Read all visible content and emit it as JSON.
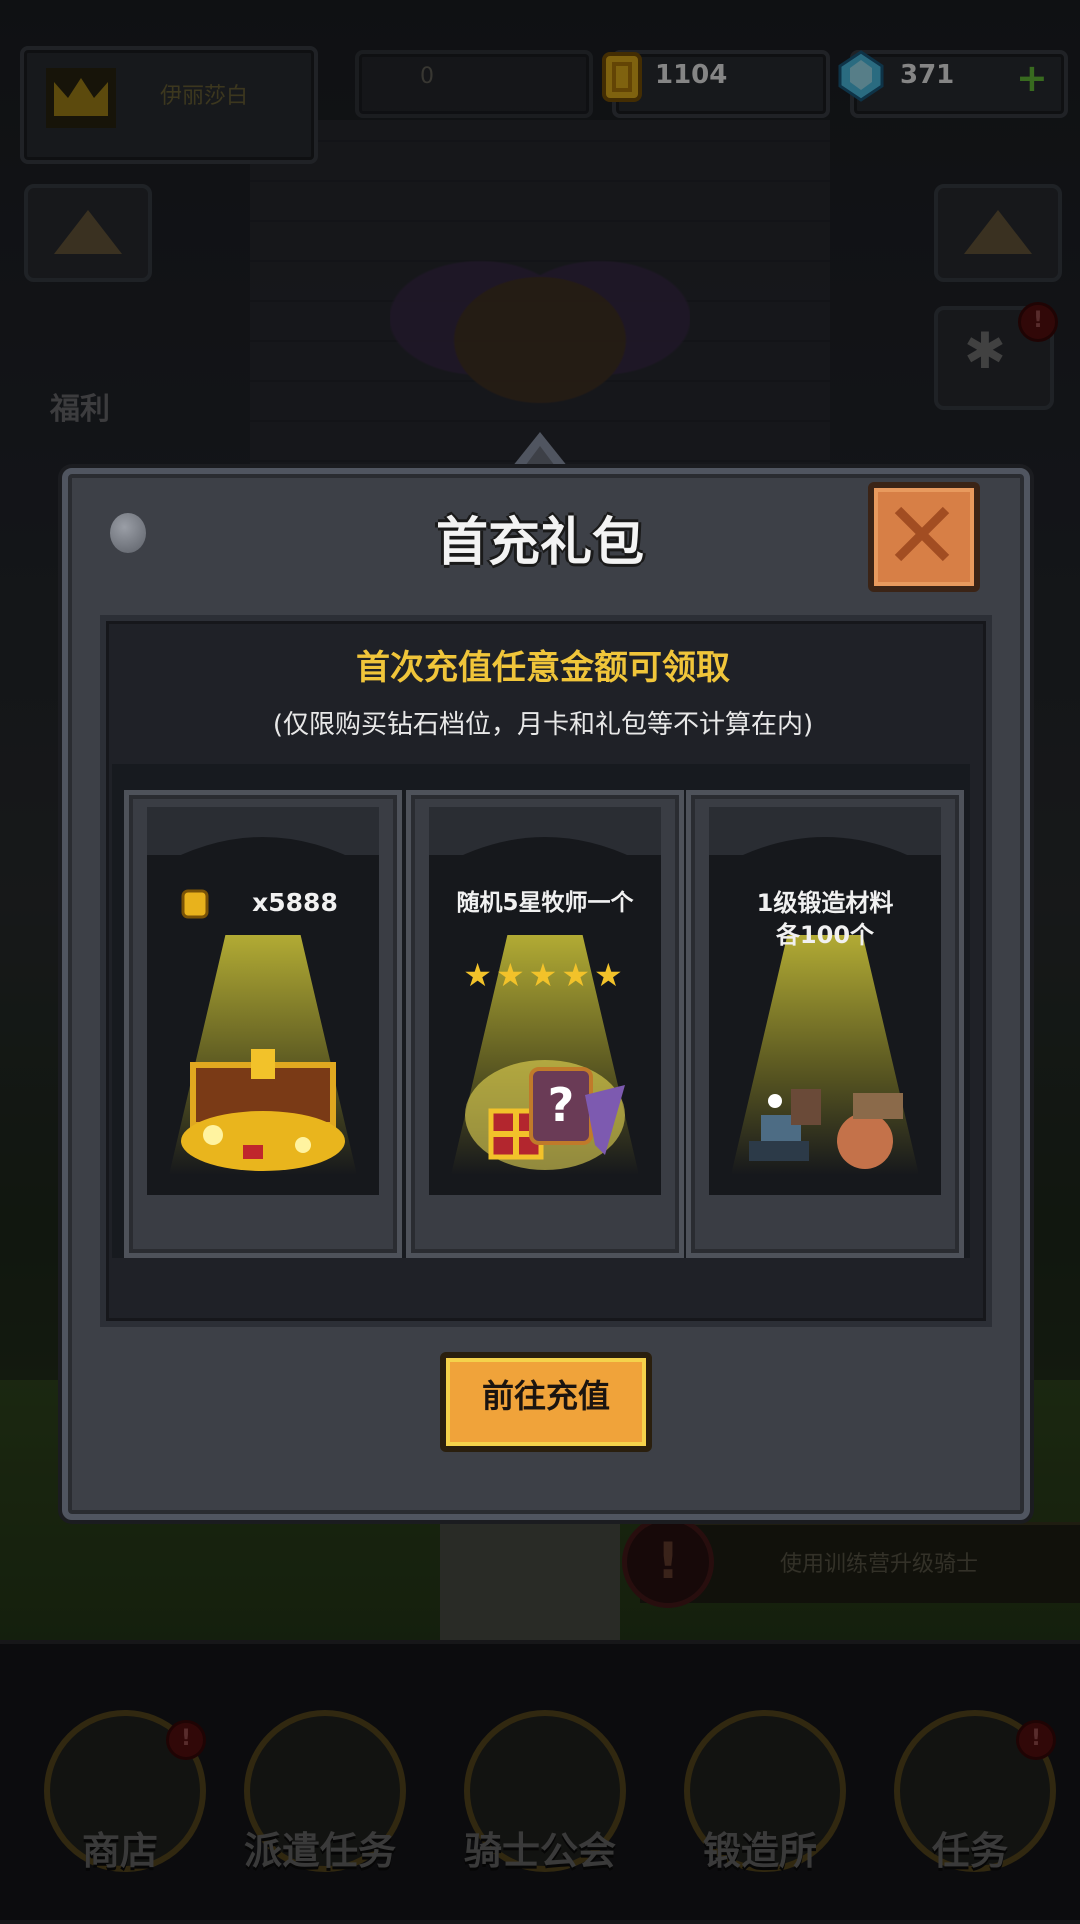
{
  "hud": {
    "player_name": "伊丽莎白",
    "honor_value": "0",
    "gold_value": "1104",
    "gem_value": "371",
    "gem_plus": "+"
  },
  "side": {
    "welfare_label": "福利",
    "settings_glyph": "✱",
    "badge_glyph": "!"
  },
  "notice": {
    "icon_glyph": "!",
    "text": "使用训练营升级骑士"
  },
  "nav": {
    "items": [
      {
        "label": "商店",
        "icon": "shop-icon"
      },
      {
        "label": "派遣任务",
        "icon": "dispatch-icon"
      },
      {
        "label": "骑士公会",
        "icon": "knight-icon"
      },
      {
        "label": "锻造所",
        "icon": "forge-icon"
      },
      {
        "label": "任务",
        "icon": "quest-icon"
      }
    ]
  },
  "modal": {
    "title": "首充礼包",
    "headline": "首次充值任意金额可领取",
    "subline": "(仅限购买钻石档位，月卡和礼包等不计算在内)",
    "cards": [
      {
        "title": "x5888",
        "icon": "gold-coin-icon"
      },
      {
        "title": "随机5星牧师一个",
        "stars": "★★★★★"
      },
      {
        "title_line1": "1级锻造材料",
        "title_line2": "各100个"
      }
    ],
    "button_label": "前往充值"
  },
  "colors": {
    "accent_gold": "#f0c53a",
    "button_orange": "#f0a33a",
    "close_orange": "#d77f46",
    "modal_bg": "#3d4047"
  }
}
